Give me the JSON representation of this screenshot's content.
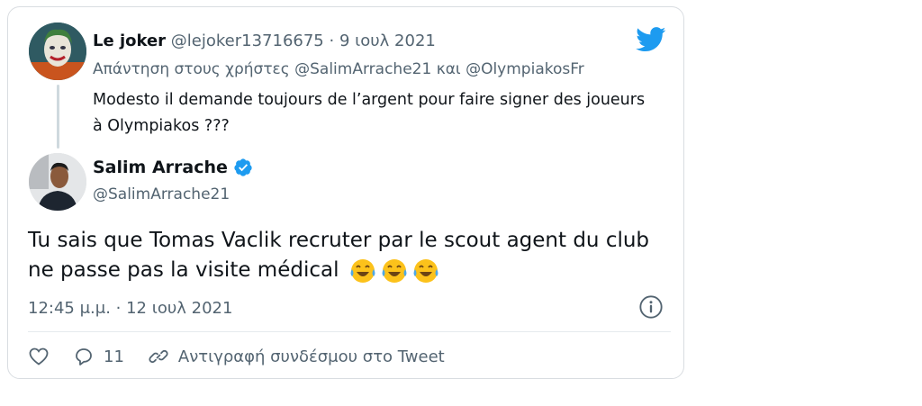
{
  "reply": {
    "display_name": "Le joker",
    "handle": "@lejoker13716675",
    "separator": "·",
    "date": "9 ιουλ 2021",
    "replying_prefix": "Απάντηση στους χρήστες",
    "mention_1": "@SalimArrache21",
    "mention_and": "και",
    "mention_2": "@OlympiakosFr",
    "text": "Modesto il demande toujours de l’argent pour faire signer des joueurs à Olympiakos ???"
  },
  "tweet": {
    "display_name": "Salim Arrache",
    "handle": "@SalimArrache21",
    "text": "Tu sais que Tomas Vaclik recruter par le scout agent du club ne passe pas la visite médical",
    "emoji_names": [
      "tears-of-joy-emoji",
      "tears-of-joy-emoji",
      "tears-of-joy-emoji"
    ],
    "timestamp": "12:45 μ.μ. · 12 ιουλ 2021"
  },
  "actions": {
    "like_icon": "heart-icon",
    "reply_icon": "comment-icon",
    "reply_count": "11",
    "copy_icon": "link-icon",
    "copy_label": "Αντιγραφή συνδέσμου στο Tweet"
  },
  "colors": {
    "twitter_blue": "#1d9bf0",
    "text_primary": "#0f1419",
    "text_muted": "#536471",
    "border": "#d9dde1"
  }
}
